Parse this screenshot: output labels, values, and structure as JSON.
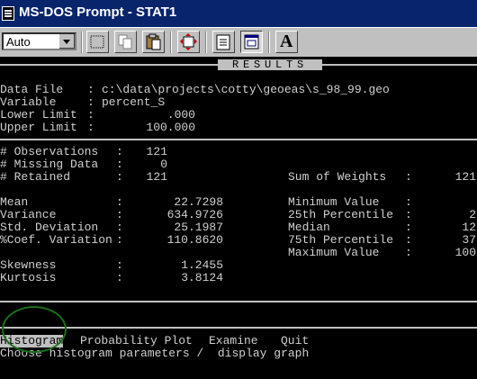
{
  "window": {
    "title": "MS-DOS Prompt - STAT1"
  },
  "toolbar": {
    "font_value": "Auto",
    "buttons": [
      "mark-icon",
      "copy-icon",
      "paste-icon",
      "fullscreen-icon",
      "properties-icon",
      "background-icon",
      "font-icon"
    ],
    "font_button_glyph": "A"
  },
  "results_header": "RESULTS",
  "file_info": {
    "data_file_label": "Data File",
    "data_file_value": "c:\\data\\projects\\cotty\\geoeas\\s_98_99.geo",
    "variable_label": "Variable",
    "variable_value": "percent_S",
    "lower_label": "Lower Limit",
    "lower_value": ".000",
    "upper_label": "Upper Limit",
    "upper_value": "100.000"
  },
  "counts": {
    "obs_label": "# Observations",
    "obs_value": "121",
    "missing_label": "# Missing Data",
    "missing_value": "0",
    "retained_label": "# Retained",
    "retained_value": "121",
    "sumw_label": "Sum of Weights",
    "sumw_value": "121"
  },
  "stats": {
    "mean_label": "Mean",
    "mean_value": "22.7298",
    "variance_label": "Variance",
    "variance_value": "634.9726",
    "std_label": "Std. Deviation",
    "std_value": "25.1987",
    "cv_label": "%Coef. Variation",
    "cv_value": "110.8620",
    "skew_label": "Skewness",
    "skew_value": "1.2455",
    "kurt_label": "Kurtosis",
    "kurt_value": "3.8124",
    "min_label": "Minimum Value",
    "min_value": "",
    "p25_label": "25th Percentile",
    "p25_value": "2",
    "median_label": "Median",
    "median_value": "12",
    "p75_label": "75th Percentile",
    "p75_value": "37",
    "max_label": "Maximum Value",
    "max_value": "100"
  },
  "sep": ":",
  "menu": {
    "items": [
      "Histogram",
      "Probability Plot",
      "Examine",
      "Quit"
    ],
    "selected": 0,
    "hint": "Choose histogram parameters /  display graph"
  },
  "colors": {
    "title_bg": "#08246b",
    "console_bg": "#000000",
    "console_fg": "#d0d0d0",
    "annotation": "#1a6e1a"
  }
}
